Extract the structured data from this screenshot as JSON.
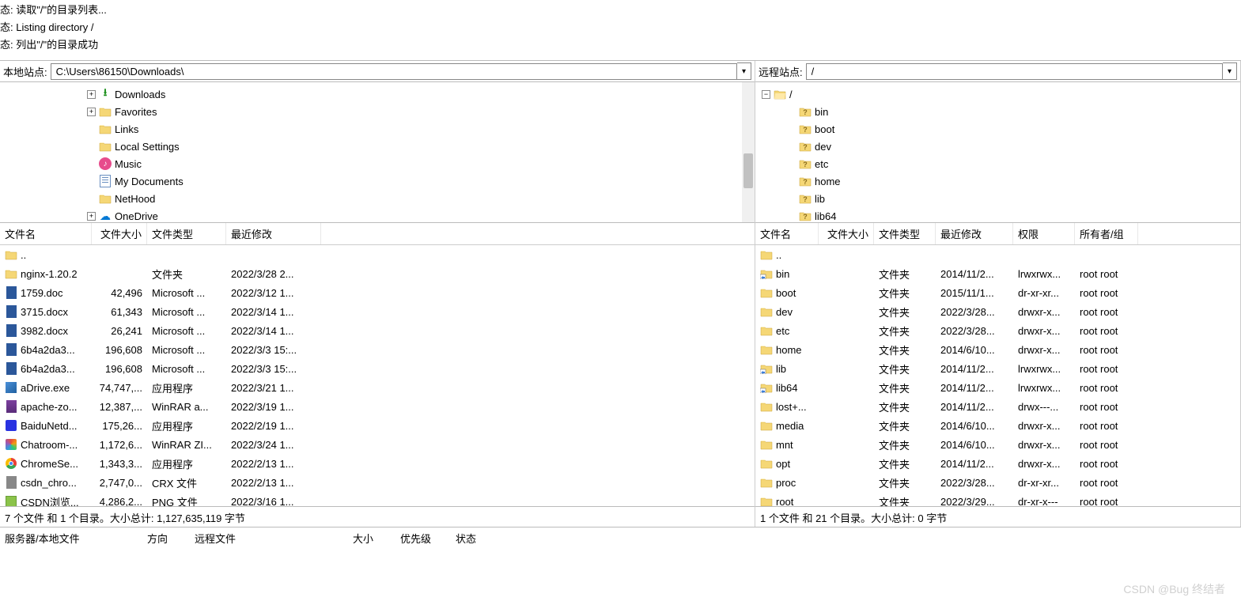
{
  "log": [
    "态:  读取\"/\"的目录列表...",
    "态:  Listing directory /",
    "态:  列出\"/\"的目录成功"
  ],
  "local": {
    "path_label": "本地站点:",
    "path_value": "C:\\Users\\86150\\Downloads\\",
    "tree": [
      {
        "indent": 110,
        "expander": "+",
        "icon": "download",
        "label": "Downloads"
      },
      {
        "indent": 110,
        "expander": "+",
        "icon": "folder",
        "label": "Favorites"
      },
      {
        "indent": 110,
        "expander": "",
        "icon": "folder",
        "label": "Links"
      },
      {
        "indent": 110,
        "expander": "",
        "icon": "folder",
        "label": "Local Settings"
      },
      {
        "indent": 110,
        "expander": "",
        "icon": "music",
        "label": "Music"
      },
      {
        "indent": 110,
        "expander": "",
        "icon": "doc",
        "label": "My Documents"
      },
      {
        "indent": 110,
        "expander": "",
        "icon": "folder",
        "label": "NetHood"
      },
      {
        "indent": 110,
        "expander": "+",
        "icon": "onedrive",
        "label": "OneDrive"
      }
    ],
    "columns": {
      "name": "文件名",
      "size": "文件大小",
      "type": "文件类型",
      "modified": "最近修改"
    },
    "col_widths": {
      "name": 116,
      "size": 70,
      "type": 100,
      "modified": 120
    },
    "files": [
      {
        "icon": "folder",
        "name": "..",
        "size": "",
        "type": "",
        "modified": ""
      },
      {
        "icon": "folder",
        "name": "nginx-1.20.2",
        "size": "",
        "type": "文件夹",
        "modified": "2022/3/28 2..."
      },
      {
        "icon": "word",
        "name": "1759.doc",
        "size": "42,496",
        "type": "Microsoft ...",
        "modified": "2022/3/12 1..."
      },
      {
        "icon": "word",
        "name": "3715.docx",
        "size": "61,343",
        "type": "Microsoft ...",
        "modified": "2022/3/14 1..."
      },
      {
        "icon": "word",
        "name": "3982.docx",
        "size": "26,241",
        "type": "Microsoft ...",
        "modified": "2022/3/14 1..."
      },
      {
        "icon": "word",
        "name": "6b4a2da3...",
        "size": "196,608",
        "type": "Microsoft ...",
        "modified": "2022/3/3 15:..."
      },
      {
        "icon": "word",
        "name": "6b4a2da3...",
        "size": "196,608",
        "type": "Microsoft ...",
        "modified": "2022/3/3 15:..."
      },
      {
        "icon": "exe",
        "name": "aDrive.exe",
        "size": "74,747,...",
        "type": "应用程序",
        "modified": "2022/3/21 1..."
      },
      {
        "icon": "rar",
        "name": "apache-zo...",
        "size": "12,387,...",
        "type": "WinRAR a...",
        "modified": "2022/3/19 1..."
      },
      {
        "icon": "baidu",
        "name": "BaiduNetd...",
        "size": "175,26...",
        "type": "应用程序",
        "modified": "2022/2/19 1..."
      },
      {
        "icon": "colorful",
        "name": "Chatroom-...",
        "size": "1,172,6...",
        "type": "WinRAR ZI...",
        "modified": "2022/3/24 1..."
      },
      {
        "icon": "chrome",
        "name": "ChromeSe...",
        "size": "1,343,3...",
        "type": "应用程序",
        "modified": "2022/2/13 1..."
      },
      {
        "icon": "crx",
        "name": "csdn_chro...",
        "size": "2,747,0...",
        "type": "CRX 文件",
        "modified": "2022/2/13 1..."
      },
      {
        "icon": "img",
        "name": "CSDN浏览...",
        "size": "4,286,2...",
        "type": "PNG 文件",
        "modified": "2022/3/16 1..."
      }
    ],
    "status": "7 个文件 和 1 个目录。大小总计: 1,127,635,119 字节"
  },
  "remote": {
    "path_label": "远程站点:",
    "path_value": "/",
    "tree_root": "/",
    "tree": [
      {
        "label": "bin"
      },
      {
        "label": "boot"
      },
      {
        "label": "dev"
      },
      {
        "label": "etc"
      },
      {
        "label": "home"
      },
      {
        "label": "lib"
      },
      {
        "label": "lib64"
      }
    ],
    "columns": {
      "name": "文件名",
      "size": "文件大小",
      "type": "文件类型",
      "modified": "最近修改",
      "perm": "权限",
      "owner": "所有者/组"
    },
    "col_widths": {
      "name": 80,
      "size": 70,
      "type": 78,
      "modified": 98,
      "perm": 78,
      "owner": 80
    },
    "files": [
      {
        "icon": "folder",
        "name": "..",
        "size": "",
        "type": "",
        "modified": "",
        "perm": "",
        "owner": ""
      },
      {
        "icon": "folder-link",
        "name": "bin",
        "size": "",
        "type": "文件夹",
        "modified": "2014/11/2...",
        "perm": "lrwxrwx...",
        "owner": "root root"
      },
      {
        "icon": "folder",
        "name": "boot",
        "size": "",
        "type": "文件夹",
        "modified": "2015/11/1...",
        "perm": "dr-xr-xr...",
        "owner": "root root"
      },
      {
        "icon": "folder",
        "name": "dev",
        "size": "",
        "type": "文件夹",
        "modified": "2022/3/28...",
        "perm": "drwxr-x...",
        "owner": "root root"
      },
      {
        "icon": "folder",
        "name": "etc",
        "size": "",
        "type": "文件夹",
        "modified": "2022/3/28...",
        "perm": "drwxr-x...",
        "owner": "root root"
      },
      {
        "icon": "folder",
        "name": "home",
        "size": "",
        "type": "文件夹",
        "modified": "2014/6/10...",
        "perm": "drwxr-x...",
        "owner": "root root"
      },
      {
        "icon": "folder-link",
        "name": "lib",
        "size": "",
        "type": "文件夹",
        "modified": "2014/11/2...",
        "perm": "lrwxrwx...",
        "owner": "root root"
      },
      {
        "icon": "folder-link",
        "name": "lib64",
        "size": "",
        "type": "文件夹",
        "modified": "2014/11/2...",
        "perm": "lrwxrwx...",
        "owner": "root root"
      },
      {
        "icon": "folder",
        "name": "lost+...",
        "size": "",
        "type": "文件夹",
        "modified": "2014/11/2...",
        "perm": "drwx---...",
        "owner": "root root"
      },
      {
        "icon": "folder",
        "name": "media",
        "size": "",
        "type": "文件夹",
        "modified": "2014/6/10...",
        "perm": "drwxr-x...",
        "owner": "root root"
      },
      {
        "icon": "folder",
        "name": "mnt",
        "size": "",
        "type": "文件夹",
        "modified": "2014/6/10...",
        "perm": "drwxr-x...",
        "owner": "root root"
      },
      {
        "icon": "folder",
        "name": "opt",
        "size": "",
        "type": "文件夹",
        "modified": "2014/11/2...",
        "perm": "drwxr-x...",
        "owner": "root root"
      },
      {
        "icon": "folder",
        "name": "proc",
        "size": "",
        "type": "文件夹",
        "modified": "2022/3/28...",
        "perm": "dr-xr-xr...",
        "owner": "root root"
      },
      {
        "icon": "folder",
        "name": "root",
        "size": "",
        "type": "文件夹",
        "modified": "2022/3/29...",
        "perm": "dr-xr-x---",
        "owner": "root root"
      }
    ],
    "status": "1 个文件 和 21 个目录。大小总计: 0 字节"
  },
  "queue": {
    "cols": [
      "服务器/本地文件",
      "方向",
      "远程文件",
      "大小",
      "优先级",
      "状态"
    ]
  },
  "watermark": "CSDN @Bug 终结者"
}
